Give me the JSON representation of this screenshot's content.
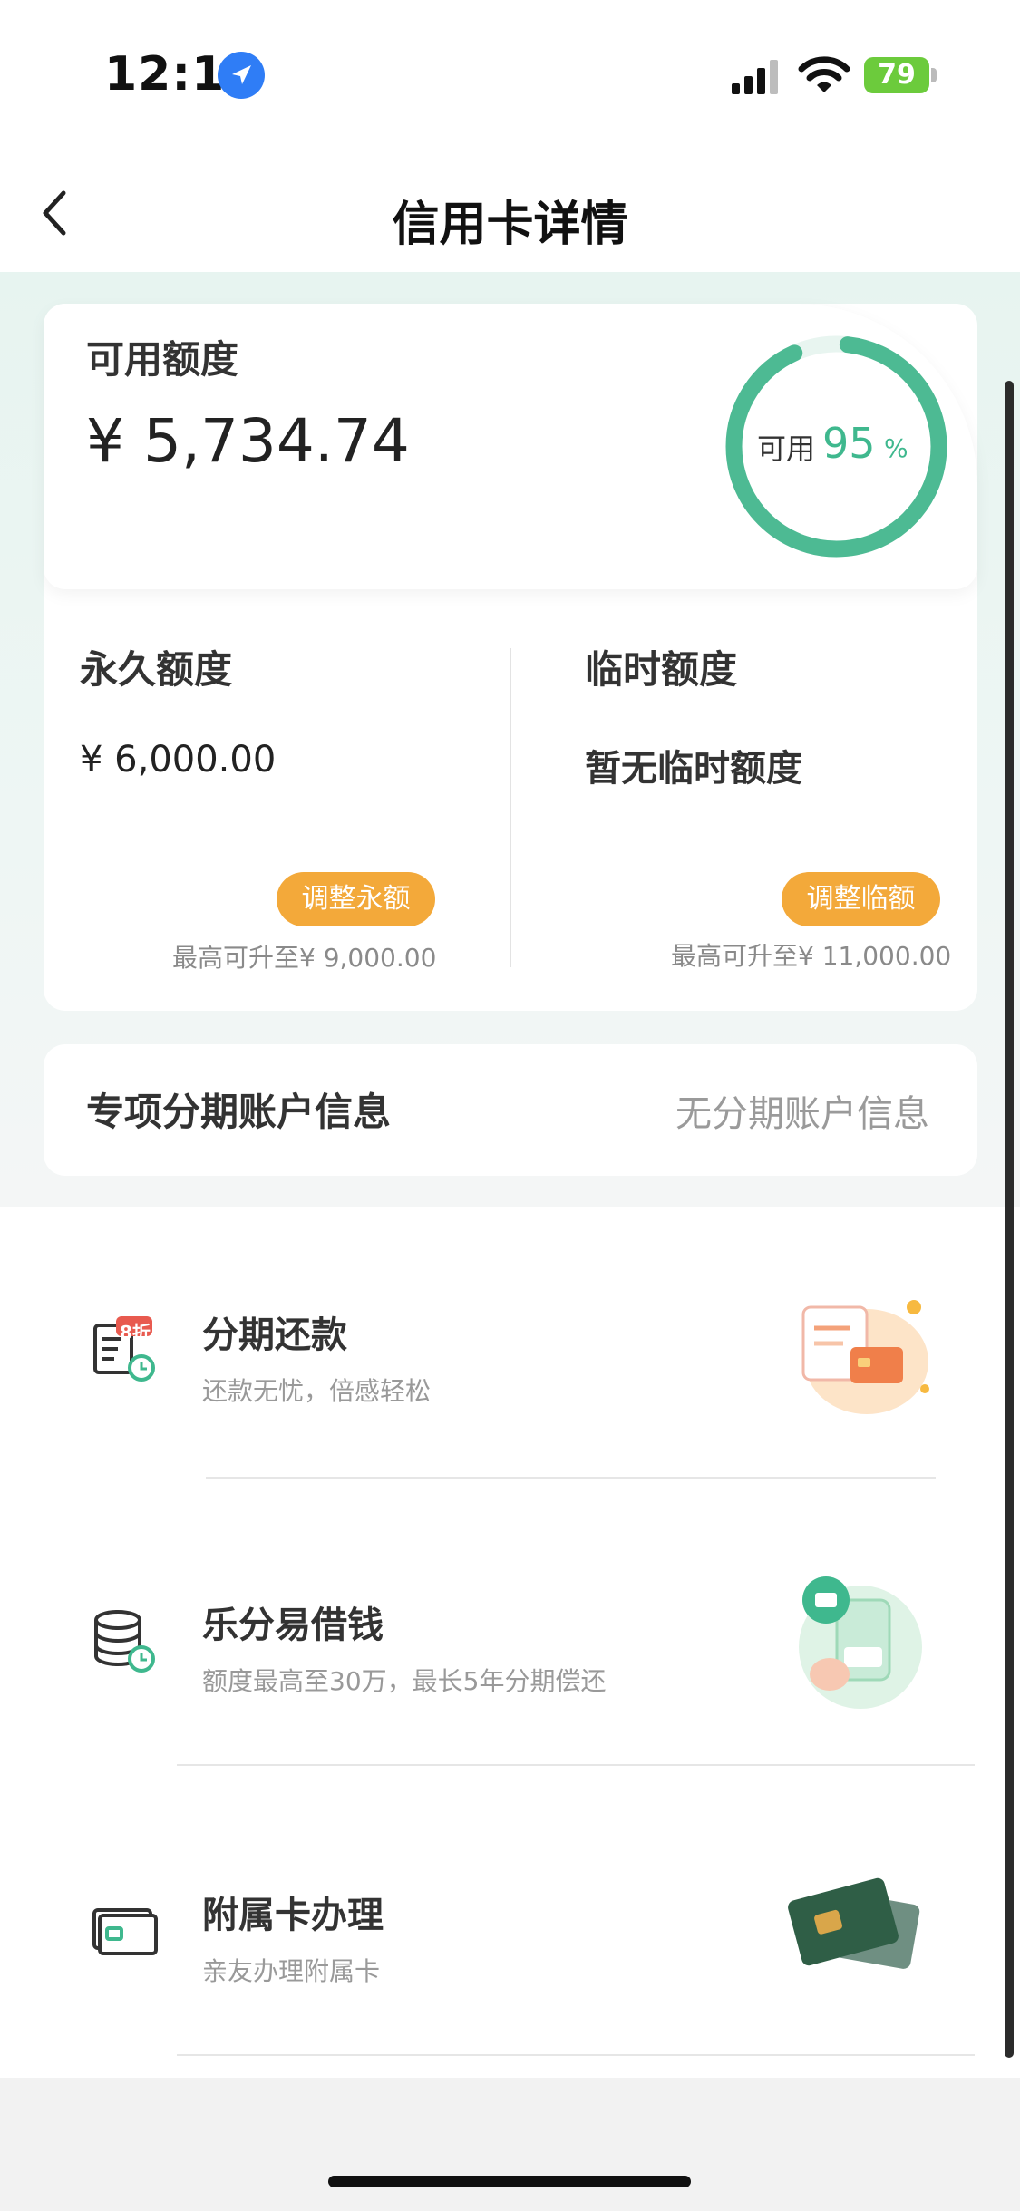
{
  "status_bar": {
    "time": "12:10",
    "battery": "79"
  },
  "nav": {
    "title": "信用卡详情"
  },
  "available": {
    "label": "可用额度",
    "amount": "¥ 5,734.74",
    "ring_label": "可用",
    "percent_value": "95",
    "percent_unit": "%",
    "percent_fraction": 0.95,
    "ring_color": "#4dba93"
  },
  "permanent": {
    "label": "永久额度",
    "value": "¥ 6,000.00",
    "button": "调整永额",
    "max": "最高可升至¥ 9,000.00"
  },
  "temporary": {
    "label": "临时额度",
    "value": "暂无临时额度",
    "button": "调整临额",
    "max": "最高可升至¥ 11,000.00"
  },
  "installment_account": {
    "label": "专项分期账户信息",
    "value": "无分期账户信息"
  },
  "services": [
    {
      "title": "分期还款",
      "subtitle": "还款无忧，倍感轻松",
      "badge": "8折",
      "icon": "bill-clock-icon"
    },
    {
      "title": "乐分易借钱",
      "subtitle": "额度最高至30万，最长5年分期偿还",
      "icon": "coins-clock-icon"
    },
    {
      "title": "附属卡办理",
      "subtitle": "亲友办理附属卡",
      "icon": "card-icon"
    }
  ],
  "colors": {
    "accent_green": "#3fb88e",
    "button_orange": "#f3a93a"
  }
}
